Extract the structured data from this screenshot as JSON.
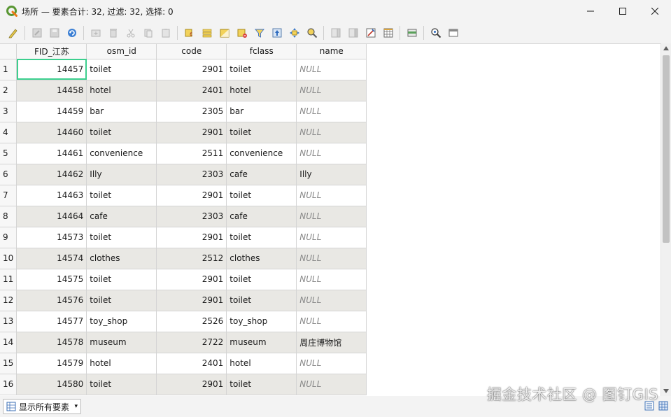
{
  "window": {
    "title": "场所 — 要素合计: 32, 过滤: 32, 选择: 0",
    "icon": "qgis-logo-icon",
    "controls": [
      "minimize-icon",
      "maximize-icon",
      "close-icon"
    ]
  },
  "toolbar": {
    "buttons": [
      "toggle-editing-icon",
      "multi-edit-icon",
      "save-edits-icon",
      "reload-icon",
      "add-feature-icon",
      "delete-feature-icon",
      "cut-icon",
      "copy-icon",
      "paste-icon",
      "select-by-expression-icon",
      "select-all-icon",
      "invert-selection-icon",
      "deselect-all-icon",
      "filter-select-icon",
      "move-selection-top-icon",
      "pan-to-selected-icon",
      "zoom-to-selected-icon",
      "new-field-icon",
      "delete-field-icon",
      "field-calculator-icon",
      "conditional-formatting-icon",
      "dock-table-icon",
      "actions-icon",
      "dock-icon"
    ]
  },
  "table": {
    "columns": [
      "FID_江苏",
      "osm_id",
      "code",
      "fclass",
      "name"
    ],
    "selected_cell": {
      "row": 1,
      "col": "FID_江苏"
    },
    "rows": [
      {
        "n": "1",
        "fid": "14457",
        "osm": "toilet",
        "code": "2901",
        "fclass": "toilet",
        "name": "NULL"
      },
      {
        "n": "2",
        "fid": "14458",
        "osm": "hotel",
        "code": "2401",
        "fclass": "hotel",
        "name": "NULL"
      },
      {
        "n": "3",
        "fid": "14459",
        "osm": "bar",
        "code": "2305",
        "fclass": "bar",
        "name": "NULL"
      },
      {
        "n": "4",
        "fid": "14460",
        "osm": "toilet",
        "code": "2901",
        "fclass": "toilet",
        "name": "NULL"
      },
      {
        "n": "5",
        "fid": "14461",
        "osm": "convenience",
        "code": "2511",
        "fclass": "convenience",
        "name": "NULL"
      },
      {
        "n": "6",
        "fid": "14462",
        "osm": "Illy",
        "code": "2303",
        "fclass": "cafe",
        "name": "Illy"
      },
      {
        "n": "7",
        "fid": "14463",
        "osm": "toilet",
        "code": "2901",
        "fclass": "toilet",
        "name": "NULL"
      },
      {
        "n": "8",
        "fid": "14464",
        "osm": "cafe",
        "code": "2303",
        "fclass": "cafe",
        "name": "NULL"
      },
      {
        "n": "9",
        "fid": "14573",
        "osm": "toilet",
        "code": "2901",
        "fclass": "toilet",
        "name": "NULL"
      },
      {
        "n": "10",
        "fid": "14574",
        "osm": "clothes",
        "code": "2512",
        "fclass": "clothes",
        "name": "NULL"
      },
      {
        "n": "11",
        "fid": "14575",
        "osm": "toilet",
        "code": "2901",
        "fclass": "toilet",
        "name": "NULL"
      },
      {
        "n": "12",
        "fid": "14576",
        "osm": "toilet",
        "code": "2901",
        "fclass": "toilet",
        "name": "NULL"
      },
      {
        "n": "13",
        "fid": "14577",
        "osm": "toy_shop",
        "code": "2526",
        "fclass": "toy_shop",
        "name": "NULL"
      },
      {
        "n": "14",
        "fid": "14578",
        "osm": "museum",
        "code": "2722",
        "fclass": "museum",
        "name": "周庄博物馆"
      },
      {
        "n": "15",
        "fid": "14579",
        "osm": "hotel",
        "code": "2401",
        "fclass": "hotel",
        "name": "NULL"
      },
      {
        "n": "16",
        "fid": "14580",
        "osm": "toilet",
        "code": "2901",
        "fclass": "toilet",
        "name": "NULL"
      }
    ]
  },
  "statusbar": {
    "filter_label": "显示所有要素",
    "view_buttons": [
      "form-view-icon",
      "table-view-icon"
    ]
  },
  "watermark": "掘金技术社区 @ 图钉GIS",
  "colors": {
    "selection_outline": "#3ccf8e",
    "alt_row": "#e9e8e4",
    "null_text": "#8a8a8a"
  }
}
